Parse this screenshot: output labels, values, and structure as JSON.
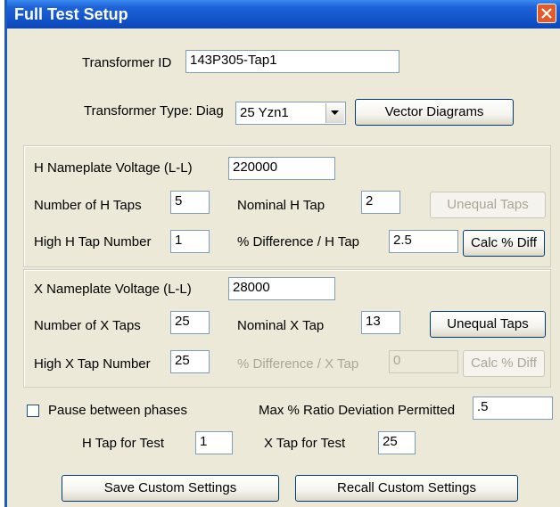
{
  "window": {
    "title": "Full Test Setup"
  },
  "transformer_id": {
    "label": "Transformer ID",
    "value": "143P305-Tap1"
  },
  "transformer_type": {
    "label": "Transformer Type: Diag",
    "value": "25  Yzn1",
    "vector_button": "Vector Diagrams"
  },
  "h_group": {
    "nameplate_label": "H Nameplate Voltage (L-L)",
    "nameplate_value": "220000",
    "taps_label": "Number of H Taps",
    "taps_value": "5",
    "nominal_label": "Nominal H Tap",
    "nominal_value": "2",
    "unequal_button": "Unequal Taps",
    "high_label": "High H Tap Number",
    "high_value": "1",
    "diff_label": "% Difference / H Tap",
    "diff_value": "2.5",
    "calc_button": "Calc % Diff"
  },
  "x_group": {
    "nameplate_label": "X Nameplate Voltage (L-L)",
    "nameplate_value": "28000",
    "taps_label": "Number of X Taps",
    "taps_value": "25",
    "nominal_label": "Nominal X Tap",
    "nominal_value": "13",
    "unequal_button": "Unequal Taps",
    "high_label": "High X Tap Number",
    "high_value": "25",
    "diff_label": "% Difference / X Tap",
    "diff_value": "0",
    "calc_button": "Calc % Diff"
  },
  "options": {
    "pause_label": "Pause between phases",
    "max_label": "Max % Ratio Deviation Permitted",
    "max_value": ".5",
    "h_test_label": "H Tap for Test",
    "h_test_value": "1",
    "x_test_label": "X Tap for Test",
    "x_test_value": "25"
  },
  "buttons": {
    "save": "Save Custom Settings",
    "recall": "Recall Custom Settings"
  }
}
